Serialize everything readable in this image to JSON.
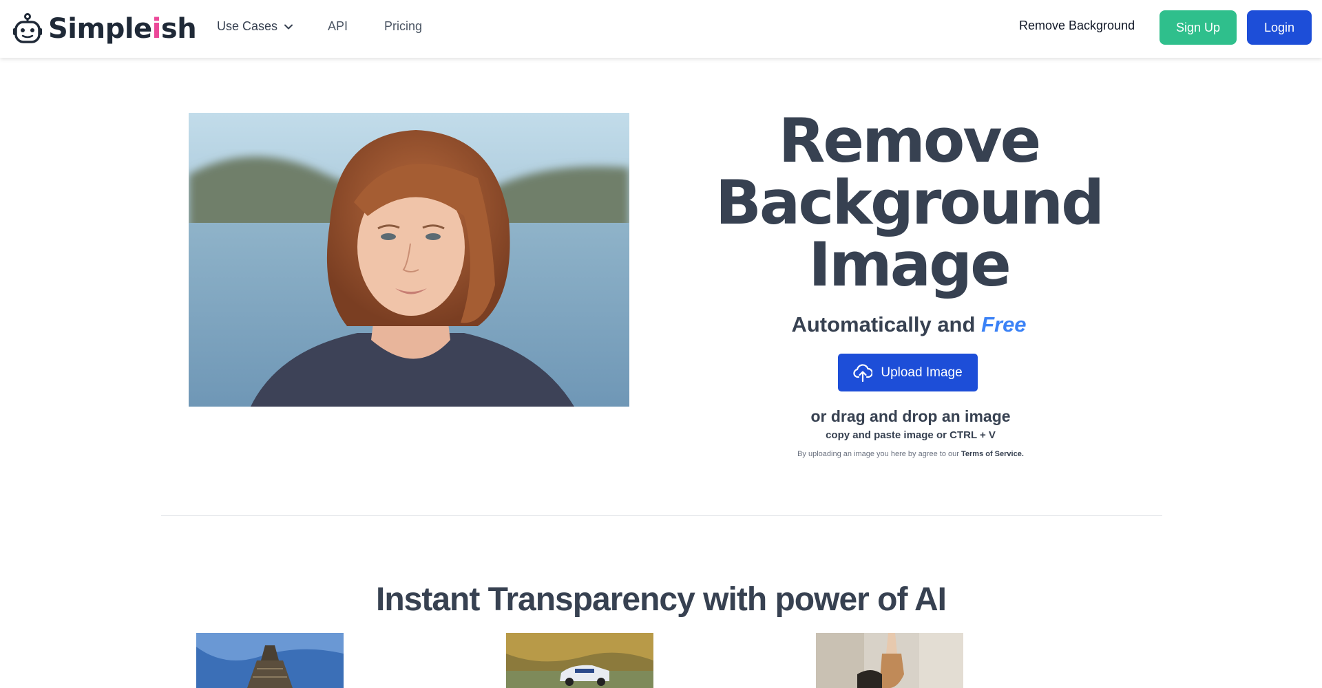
{
  "header": {
    "logo": {
      "prefix": "Simple",
      "accent": "i",
      "suffix": "sh"
    },
    "nav": [
      {
        "label": "Use Cases",
        "has_dropdown": true
      },
      {
        "label": "API"
      },
      {
        "label": "Pricing"
      }
    ],
    "remove_background_link": "Remove Background",
    "signup_label": "Sign Up",
    "login_label": "Login"
  },
  "hero": {
    "title_line1": "Remove",
    "title_line2": "Background",
    "title_line3": "Image",
    "subtitle_prefix": "Automatically and",
    "subtitle_accent": "Free",
    "upload_label": "Upload Image",
    "drag_text": "or drag and drop an image",
    "paste_text": "copy and paste image or CTRL + V",
    "tos_prefix": "By uploading an image you here by agree to our",
    "tos_link": "Terms of Service."
  },
  "section": {
    "title": "Instant Transparency with power of AI"
  },
  "colors": {
    "accent_green": "#2fbf8c",
    "accent_blue": "#1d4ed8",
    "free_blue": "#3b82f6",
    "logo_pink": "#ec4899",
    "text_dark": "#374151"
  },
  "icons": {
    "logo": "robot-icon",
    "dropdown": "chevron-down-icon",
    "upload": "cloud-upload-icon"
  }
}
